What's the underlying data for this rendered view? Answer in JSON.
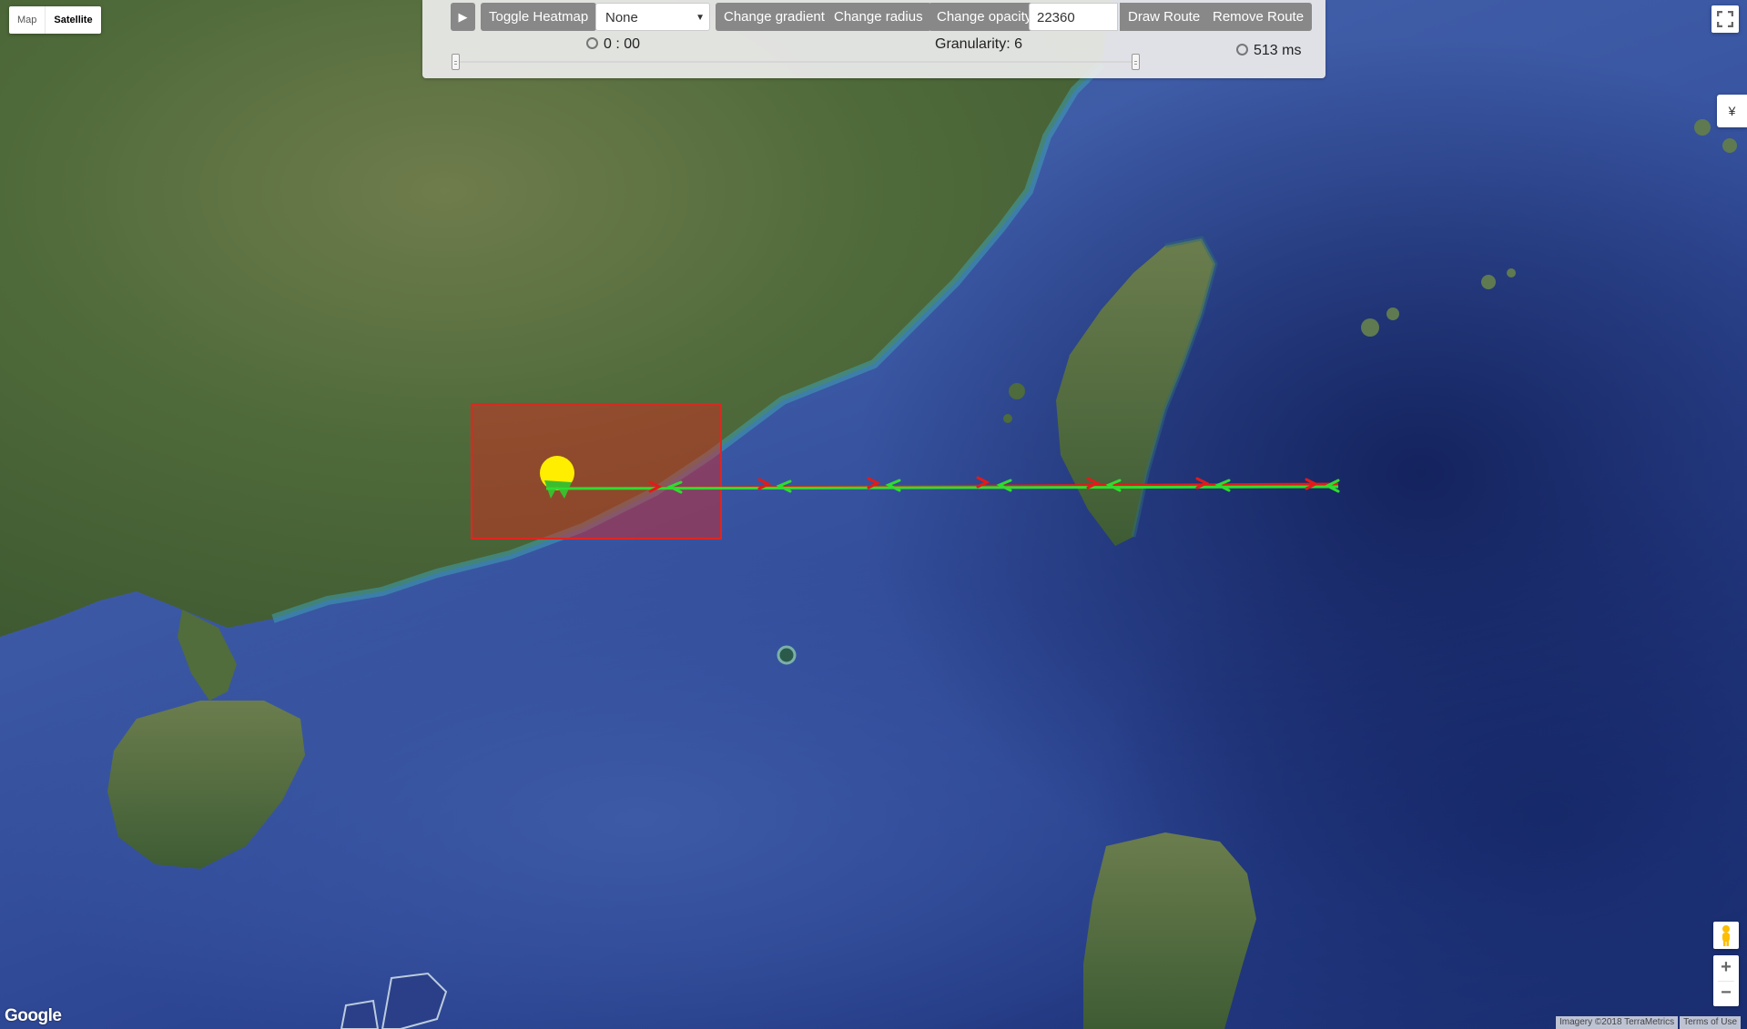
{
  "panel": {
    "play_icon": "play-icon",
    "toggle_heatmap": "Toggle Heatmap",
    "select_value": "None",
    "change_gradient": "Change gradient",
    "change_radius": "Change radius",
    "change_opacity": "Change opacity",
    "number_value": "22360",
    "draw_route": "Draw Route",
    "remove_route": "Remove Route",
    "timer": "0 : 00",
    "granularity": "Granularity: 6",
    "elapsed": "513 ms"
  },
  "map_type": {
    "map_label": "Map",
    "satellite_label": "Satellite",
    "selected": "Satellite"
  },
  "controls": {
    "fullscreen_icon": "fullscreen-icon",
    "yen_label": "¥",
    "zoom_in": "+",
    "zoom_out": "−"
  },
  "footer": {
    "logo": "Google",
    "imagery": "Imagery ©2018 TerraMetrics",
    "terms": "Terms of Use"
  },
  "overlay": {
    "rectangle_color": "#e0261f",
    "heat_color": "#ffee00",
    "route_outbound_color": "#2fdc2f",
    "route_return_color": "#e31a1a"
  }
}
